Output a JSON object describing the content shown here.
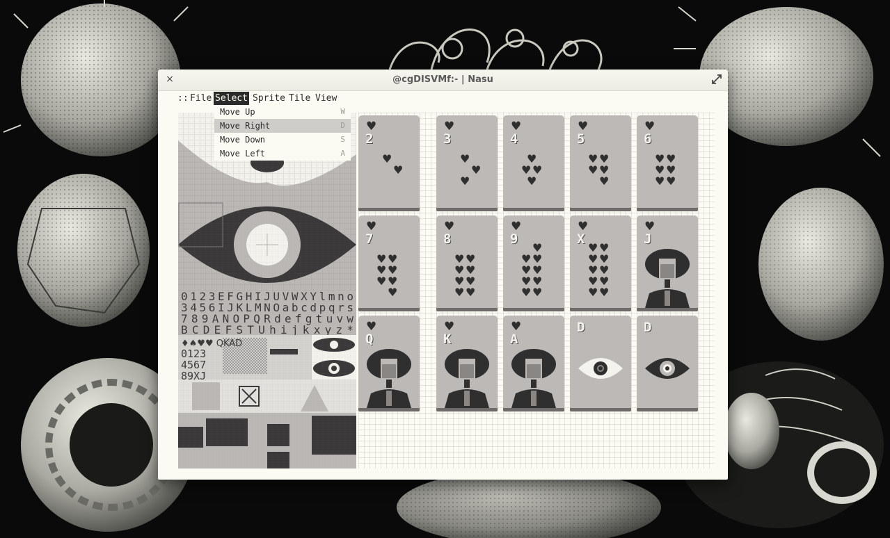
{
  "window": {
    "title": "@cgDISVMf:- | Nasu",
    "close_glyph": "×"
  },
  "menubar": {
    "handle": "::",
    "items": [
      {
        "label": "File",
        "active": false
      },
      {
        "label": "Select",
        "active": true
      },
      {
        "label": "Sprite",
        "active": false
      },
      {
        "label": "Tile",
        "active": false
      },
      {
        "label": "View",
        "active": false
      }
    ]
  },
  "select_menu": {
    "items": [
      {
        "label": "Move Up",
        "shortcut": "W",
        "highlighted": false
      },
      {
        "label": "Move Right",
        "shortcut": "D",
        "highlighted": true
      },
      {
        "label": "Move Down",
        "shortcut": "S",
        "highlighted": false
      },
      {
        "label": "Move Left",
        "shortcut": "A",
        "highlighted": false
      }
    ]
  },
  "tilesheet": {
    "font_rows": [
      "0123EFGHIJUVWXYlmno",
      "3456IJKLMNOabcdpqrs",
      "789ANOPQRdefgtuvw",
      "BCDEFSTUhijkxyz*",
      "0123",
      "4567",
      "89XJ"
    ]
  },
  "cards": [
    {
      "suit": "♥",
      "rank": "2",
      "pips": 2,
      "face": "none"
    },
    {
      "suit": "♥",
      "rank": "3",
      "pips": 3,
      "face": "none"
    },
    {
      "suit": "♥",
      "rank": "4",
      "pips": 4,
      "face": "none"
    },
    {
      "suit": "♥",
      "rank": "5",
      "pips": 5,
      "face": "none"
    },
    {
      "suit": "♥",
      "rank": "6",
      "pips": 6,
      "face": "none"
    },
    {
      "suit": "♥",
      "rank": "7",
      "pips": 7,
      "face": "none"
    },
    {
      "suit": "♥",
      "rank": "8",
      "pips": 8,
      "face": "none"
    },
    {
      "suit": "♥",
      "rank": "9",
      "pips": 9,
      "face": "none"
    },
    {
      "suit": "♥",
      "rank": "X",
      "pips": 10,
      "face": "none"
    },
    {
      "suit": "♥",
      "rank": "J",
      "pips": 0,
      "face": "portrait"
    },
    {
      "suit": "♥",
      "rank": "Q",
      "pips": 0,
      "face": "portrait"
    },
    {
      "suit": "♥",
      "rank": "K",
      "pips": 0,
      "face": "portrait"
    },
    {
      "suit": "♥",
      "rank": "A",
      "pips": 0,
      "face": "portrait"
    },
    {
      "suit": "",
      "rank": "D",
      "pips": 0,
      "face": "eye-light"
    },
    {
      "suit": "",
      "rank": "D",
      "pips": 0,
      "face": "eye-dark"
    }
  ],
  "colors": {
    "card": "#bcb9b7",
    "card_edge": "#6e6a6a",
    "ink": "#2f2f2f",
    "paper": "#fbfbf3",
    "menu_active": "#2b2b2b",
    "menu_highlight": "#cfcdc9"
  }
}
